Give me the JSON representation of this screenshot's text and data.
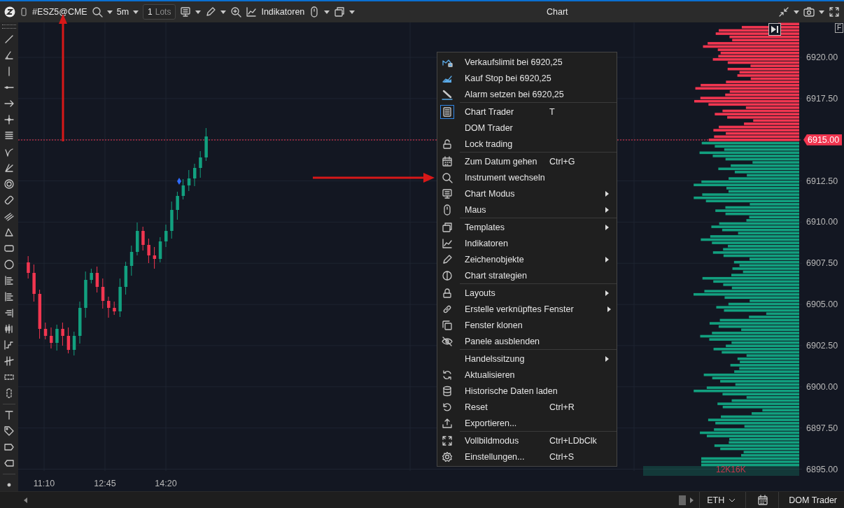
{
  "toolbar": {
    "symbol": "#ESZ5@CME",
    "interval": "5m",
    "lots_value": "1",
    "lots_label": "Lots",
    "indicators": "Indikatoren",
    "title": "Chart"
  },
  "chart": {
    "flag": "F",
    "time_labels": [
      "11:10",
      "12:45",
      "14:20"
    ],
    "volume_total": "12K16K"
  },
  "price_axis": [
    {
      "label": "6920.00",
      "current": false
    },
    {
      "label": "6917.50",
      "current": false
    },
    {
      "label": "6915.00",
      "current": true
    },
    {
      "label": "6912.50",
      "current": false
    },
    {
      "label": "6910.00",
      "current": false
    },
    {
      "label": "6907.50",
      "current": false
    },
    {
      "label": "6905.00",
      "current": false
    },
    {
      "label": "6902.50",
      "current": false
    },
    {
      "label": "6900.00",
      "current": false
    },
    {
      "label": "6897.50",
      "current": false
    },
    {
      "label": "6895.00",
      "current": false
    }
  ],
  "context_menu": {
    "groups": [
      [
        {
          "label": "Verkaufslimit bei 6920,25",
          "submenu": false,
          "checked": false
        },
        {
          "label": "Kauf Stop bei 6920,25",
          "submenu": false,
          "checked": false
        },
        {
          "label": "Alarm setzen bei 6920,25",
          "submenu": false,
          "checked": false
        }
      ],
      [
        {
          "label": "Chart Trader",
          "shortcut": "T",
          "submenu": false,
          "checked": true
        },
        {
          "label": "DOM Trader",
          "submenu": false,
          "checked": false
        },
        {
          "label": "Lock trading",
          "submenu": false,
          "checked": false
        }
      ],
      [
        {
          "label": "Zum Datum gehen",
          "shortcut": "Ctrl+G",
          "submenu": false,
          "checked": false
        },
        {
          "label": "Instrument wechseln",
          "submenu": false,
          "checked": false
        },
        {
          "label": "Chart Modus",
          "submenu": true,
          "checked": false
        },
        {
          "label": "Maus",
          "submenu": true,
          "checked": false
        }
      ],
      [
        {
          "label": "Templates",
          "submenu": true,
          "checked": false
        },
        {
          "label": "Indikatoren",
          "submenu": false,
          "checked": false
        },
        {
          "label": "Zeichenobjekte",
          "submenu": true,
          "checked": false
        },
        {
          "label": "Chart strategien",
          "submenu": false,
          "checked": false
        }
      ],
      [
        {
          "label": "Layouts",
          "submenu": true,
          "checked": false
        },
        {
          "label": "Erstelle verknüpftes Fenster",
          "submenu": true,
          "checked": false
        },
        {
          "label": "Fenster klonen",
          "submenu": false,
          "checked": false
        },
        {
          "label": "Panele ausblenden",
          "submenu": false,
          "checked": false
        }
      ],
      [
        {
          "label": "Handelssitzung",
          "submenu": true,
          "checked": false
        },
        {
          "label": "Aktualisieren",
          "submenu": false,
          "checked": false
        },
        {
          "label": "Historische Daten laden",
          "submenu": false,
          "checked": false
        },
        {
          "label": "Reset",
          "shortcut": "Ctrl+R",
          "submenu": false,
          "checked": false
        },
        {
          "label": "Exportieren...",
          "submenu": false,
          "checked": false
        }
      ],
      [
        {
          "label": "Vollbildmodus",
          "shortcut": "Ctrl+LDbClk",
          "submenu": false,
          "checked": false
        },
        {
          "label": "Einstellungen...",
          "shortcut": "Ctrl+S",
          "submenu": false,
          "checked": false
        }
      ]
    ]
  },
  "bottom_bar": {
    "session": "ETH",
    "dom_button": "DOM Trader"
  }
}
